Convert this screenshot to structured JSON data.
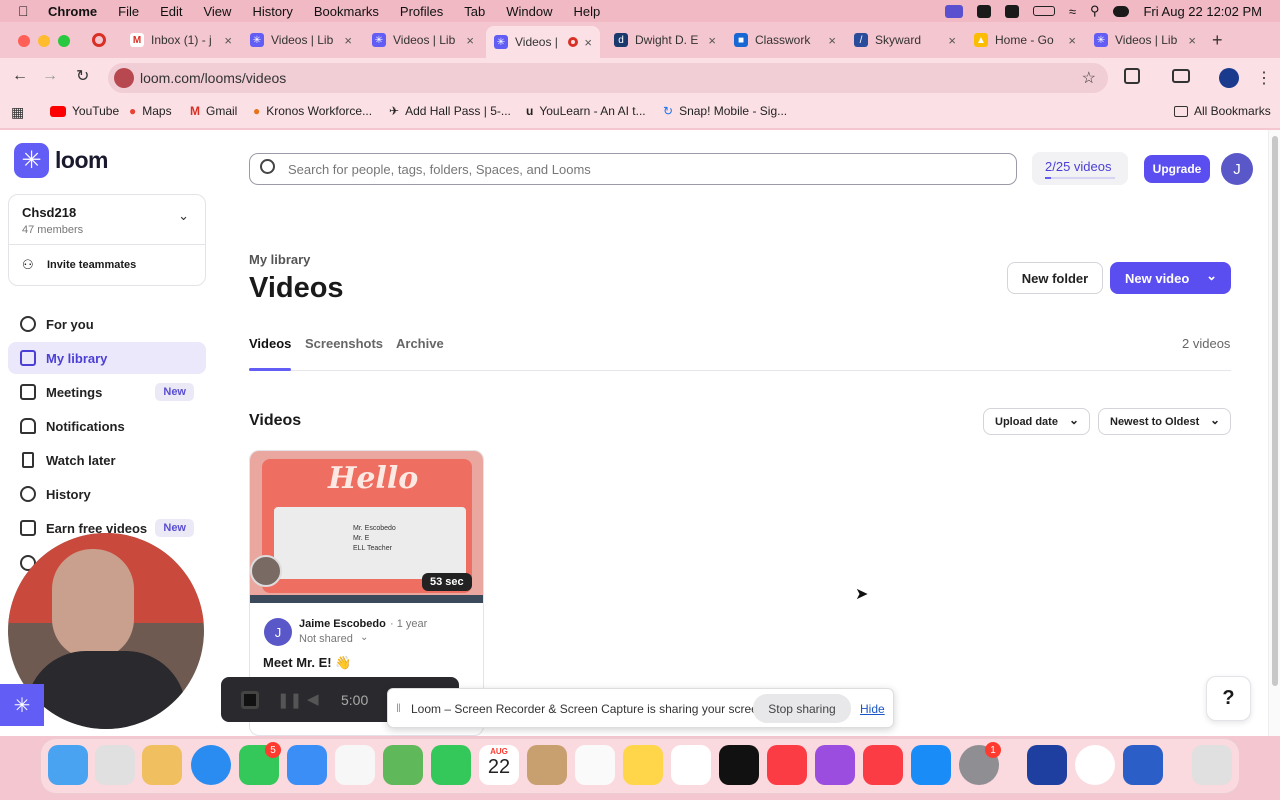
{
  "menubar": {
    "app": "Chrome",
    "items": [
      "File",
      "Edit",
      "View",
      "History",
      "Bookmarks",
      "Profiles",
      "Tab",
      "Window",
      "Help"
    ],
    "clock": "Fri Aug 22  12:02 PM"
  },
  "tabs": [
    {
      "label": "Inbox (1) - j"
    },
    {
      "label": "Videos | Lib"
    },
    {
      "label": "Videos | Lib"
    },
    {
      "label": "Videos |"
    },
    {
      "label": "Dwight D. E"
    },
    {
      "label": "Classwork"
    },
    {
      "label": "Skyward"
    },
    {
      "label": "Home - Go"
    },
    {
      "label": "Videos | Lib"
    }
  ],
  "address": {
    "url": "loom.com/looms/videos"
  },
  "bookmarks": [
    "YouTube",
    "Maps",
    "Gmail",
    "Kronos Workforce...",
    "Add Hall Pass | 5-...",
    "YouLearn - An AI t...",
    "Snap! Mobile - Sig..."
  ],
  "all_bookmarks": "All Bookmarks",
  "brand": {
    "name": "loom",
    "accent": "#625df5"
  },
  "workspace": {
    "name": "Chsd218",
    "members": "47 members",
    "invite": "Invite teammates"
  },
  "nav": [
    {
      "label": "For you",
      "badge": ""
    },
    {
      "label": "My library",
      "badge": ""
    },
    {
      "label": "Meetings",
      "badge": "New"
    },
    {
      "label": "Notifications",
      "badge": ""
    },
    {
      "label": "Watch later",
      "badge": ""
    },
    {
      "label": "History",
      "badge": ""
    },
    {
      "label": "Earn free videos",
      "badge": "New"
    }
  ],
  "search": {
    "placeholder": "Search for people, tags, folders, Spaces, and Looms"
  },
  "quota": "2/25 videos",
  "upgrade": "Upgrade",
  "avatar_initial": "J",
  "library": {
    "breadcrumb": "My library",
    "title": "Videos",
    "new_folder": "New folder",
    "new_video": "New video",
    "tabs": [
      "Videos",
      "Screenshots",
      "Archive"
    ],
    "count": "2 videos",
    "section": "Videos",
    "sort_field": "Upload date",
    "sort_order": "Newest to Oldest"
  },
  "card": {
    "hello": "Hello",
    "lines": [
      "Mr. Escobedo",
      "Mr. E",
      "ELL Teacher"
    ],
    "duration": "53 sec",
    "author": "Jaime Escobedo",
    "age": "· 1 year",
    "sharing": "Not shared",
    "title": "Meet Mr. E! 👋",
    "author_initial": "J"
  },
  "recorder": {
    "time": "5:00"
  },
  "share_banner": {
    "text": "Loom – Screen Recorder & Screen Capture is sharing your screen.",
    "stop": "Stop sharing",
    "hide": "Hide"
  },
  "help": "?",
  "dock_badges": {
    "messages": "5",
    "settings": "1",
    "calendar_month": "AUG",
    "calendar_day": "22"
  }
}
